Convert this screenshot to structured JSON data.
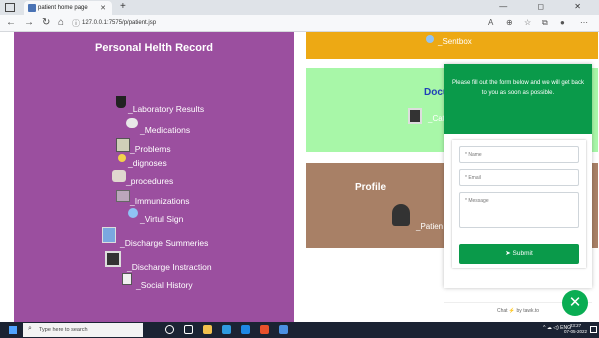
{
  "browser": {
    "tab_title": "patient home page",
    "tab_close": "✕",
    "new_tab": "+",
    "url": "127.0.0.1:7575/p/patient.jsp",
    "url_info_icon": "info-icon",
    "window_controls": "— ◻ ✕"
  },
  "sidebar": {
    "title": "Personal Helth Record",
    "items": [
      {
        "label": "_Laboratory Results",
        "icon": "lab-flask-icon"
      },
      {
        "label": "_Medications",
        "icon": "pills-icon"
      },
      {
        "label": "_Problems",
        "icon": "clipboard-icon"
      },
      {
        "label": "_dignoses",
        "icon": "diagnosis-icon"
      },
      {
        "label": "_procedures",
        "icon": "procedure-icon"
      },
      {
        "label": "_Immunizations",
        "icon": "syringe-icon"
      },
      {
        "label": "_Virtul Sign",
        "icon": "vital-sign-icon"
      },
      {
        "label": "_Discharge Summeries",
        "icon": "discharge-summary-icon"
      },
      {
        "label": "_Discharge Instraction",
        "icon": "discharge-instruction-icon"
      },
      {
        "label": "_Social History",
        "icon": "social-history-icon"
      }
    ]
  },
  "cards": {
    "sentbox_label": "_Sentbox",
    "documents_title": "Docu",
    "documents_sub": "_Cat",
    "profile_title": "Profile",
    "profile_sub": "_Patien"
  },
  "chat": {
    "header": "Please fill out the form below and we will get back to you as soon as possible.",
    "name_placeholder": "* Name",
    "email_placeholder": "* Email",
    "message_placeholder": "* Message",
    "submit_label": "Submit",
    "powered_prefix": "Chat",
    "powered_by": "by tawk.to",
    "close_icon": "✕"
  },
  "taskbar": {
    "search_placeholder": "Type here to search",
    "lang": "ENG",
    "time": "23:27",
    "date": "07-05-2022"
  },
  "colors": {
    "sidebar_bg": "#9b4f9f",
    "sentbox_bg": "#eda914",
    "documents_bg": "#a8f7a8",
    "profile_bg": "#a88066",
    "chat_accent": "#0a9a4a"
  }
}
